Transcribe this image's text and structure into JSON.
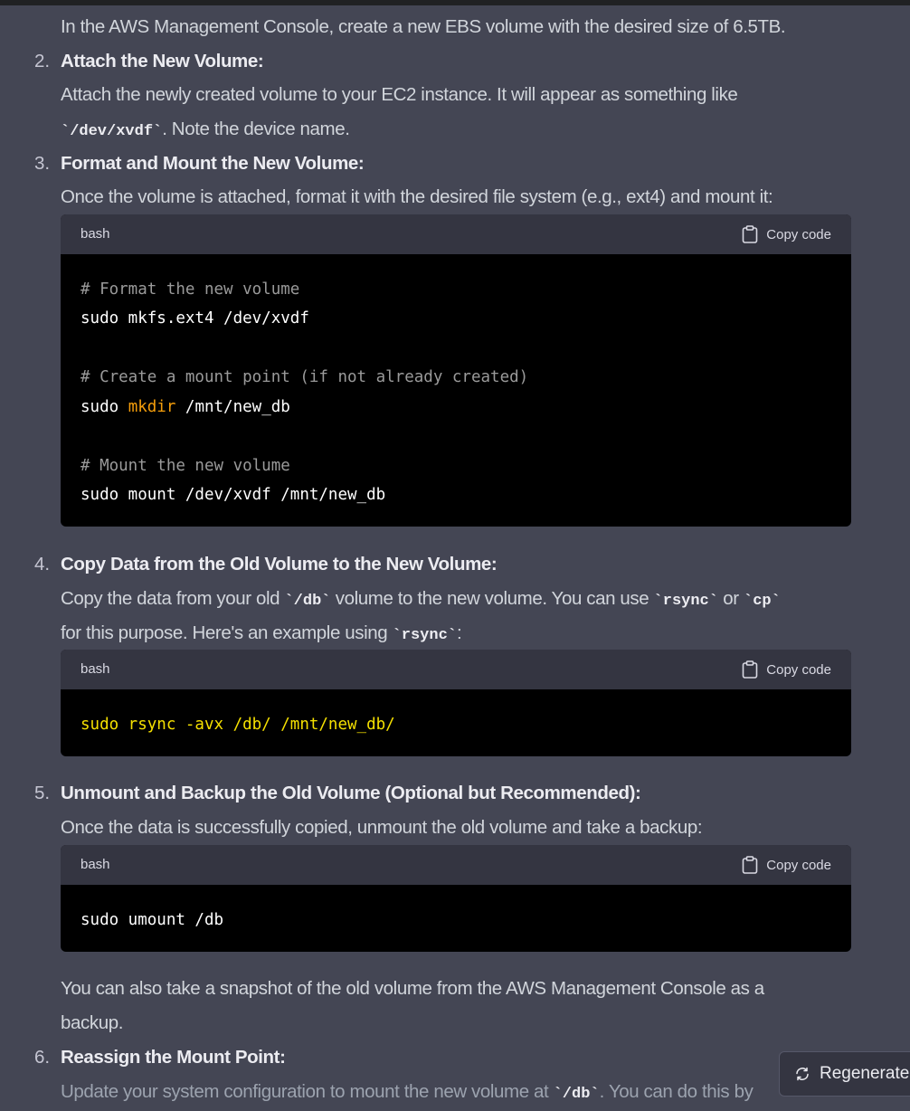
{
  "steps": {
    "s1_body": "In the AWS Management Console, create a new EBS volume with the desired size of 6.5TB.",
    "s2_num": "2.",
    "s2_title": "Attach the New Volume:",
    "s2_body_a": "Attach the newly created volume to your EC2 instance. It will appear as something like",
    "s2_code": "`/dev/xvdf`",
    "s2_body_b": ". Note the device name.",
    "s3_num": "3.",
    "s3_title": "Format and Mount the New Volume:",
    "s3_body": "Once the volume is attached, format it with the desired file system (e.g., ext4) and mount it:",
    "s4_num": "4.",
    "s4_title": "Copy Data from the Old Volume to the New Volume:",
    "s4_body_a": "Copy the data from your old ",
    "s4_code_a": "`/db`",
    "s4_body_b": " volume to the new volume. You can use ",
    "s4_code_b": "`rsync`",
    "s4_body_c": " or ",
    "s4_code_c": "`cp`",
    "s4_body_d": "for this purpose. Here's an example using ",
    "s4_code_d": "`rsync`",
    "s4_body_e": ":",
    "s5_num": "5.",
    "s5_title": "Unmount and Backup the Old Volume (Optional but Recommended):",
    "s5_body": "Once the data is successfully copied, unmount the old volume and take a backup:",
    "s5_after_a": "You can also take a snapshot of the old volume from the AWS Management Console as a",
    "s5_after_b": "backup.",
    "s6_num": "6.",
    "s6_title": "Reassign the Mount Point:",
    "s6_body_a": "Update your system configuration to mount the new volume at ",
    "s6_code": "`/db`",
    "s6_body_b": ". You can do this by"
  },
  "code_blocks": [
    {
      "lang": "bash",
      "copy_label": "Copy code",
      "lines": {
        "l1": "# Format the new volume",
        "l2": "sudo mkfs.ext4 /dev/xvdf",
        "l3": "# Create a mount point (if not already created)",
        "l4a": "sudo ",
        "l4b": "mkdir",
        "l4c": " /mnt/new_db",
        "l5": "# Mount the new volume",
        "l6": "sudo mount /dev/xvdf /mnt/new_db"
      }
    },
    {
      "lang": "bash",
      "copy_label": "Copy code",
      "lines": {
        "l1": "sudo rsync -avx /db/ /mnt/new_db/"
      }
    },
    {
      "lang": "bash",
      "copy_label": "Copy code",
      "lines": {
        "l1": "sudo umount /db"
      }
    }
  ],
  "regenerate": {
    "label": "Regenerate",
    "icon": "refresh-icon"
  },
  "colors": {
    "page_bg": "#444654",
    "code_header_bg": "#343541",
    "code_bg": "#000000",
    "comment": "#9a9a9a",
    "keyword": "#f59e0b",
    "highlight": "#f5e000"
  }
}
